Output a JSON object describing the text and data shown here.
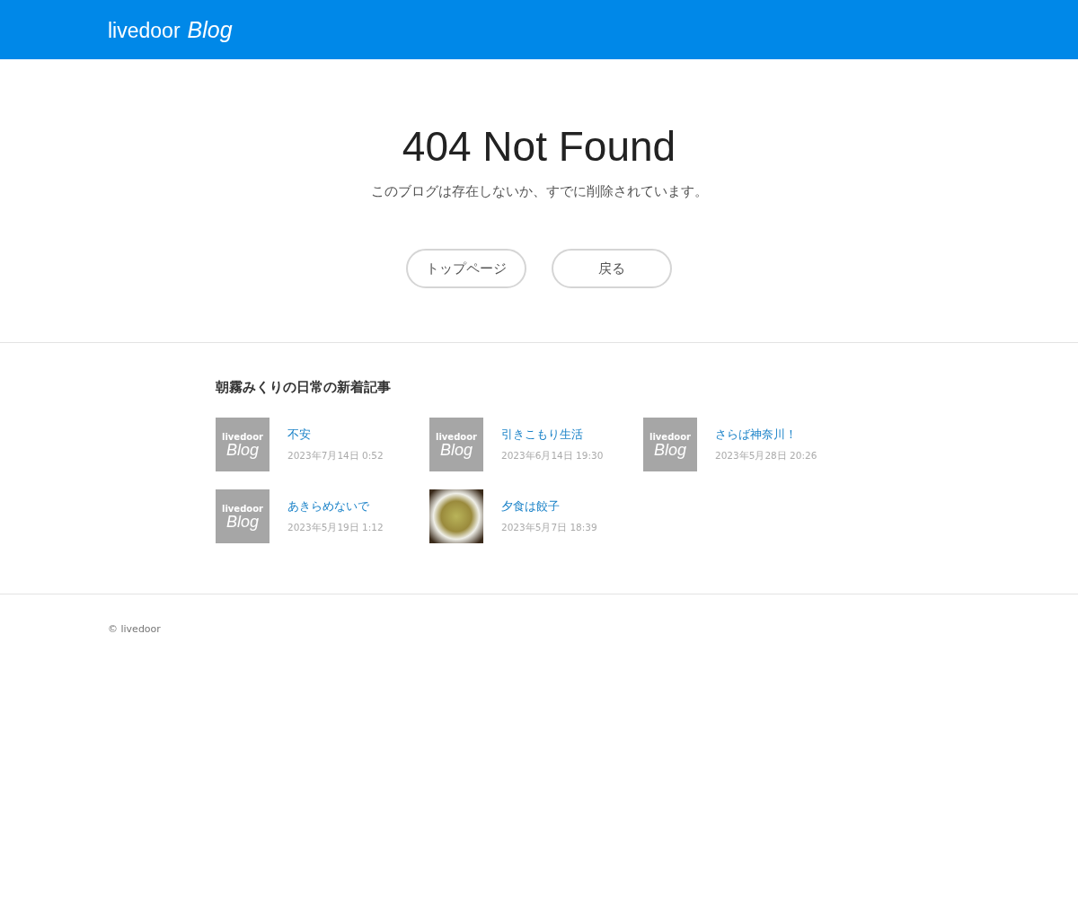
{
  "header": {
    "logo_main": "livedoor",
    "logo_sub": "Blog"
  },
  "error": {
    "title": "404 Not Found",
    "message": "このブログは存在しないか、すでに削除されています。",
    "buttons": [
      "トップページ",
      "戻る"
    ]
  },
  "recent": {
    "heading": "朝霧みくりの日常の新着記事",
    "articles": [
      {
        "title": "不安",
        "date": "2023年7月14日 0:52",
        "thumb": {
          "kind": "logo",
          "top": "livedoor",
          "bottom": "Blog"
        }
      },
      {
        "title": "引きこもり生活",
        "date": "2023年6月14日 19:30",
        "thumb": {
          "kind": "logo",
          "top": "livedoor",
          "bottom": "Blog"
        }
      },
      {
        "title": "さらば神奈川！",
        "date": "2023年5月28日 20:26",
        "thumb": {
          "kind": "logo",
          "top": "livedoor",
          "bottom": "Blog"
        }
      },
      {
        "title": "あきらめないで",
        "date": "2023年5月19日 1:12",
        "thumb": {
          "kind": "logo",
          "top": "livedoor",
          "bottom": "Blog"
        }
      },
      {
        "title": "夕食は餃子",
        "date": "2023年5月7日 18:39",
        "thumb": {
          "kind": "photo"
        }
      }
    ]
  },
  "footer": {
    "copyright": "© livedoor"
  }
}
